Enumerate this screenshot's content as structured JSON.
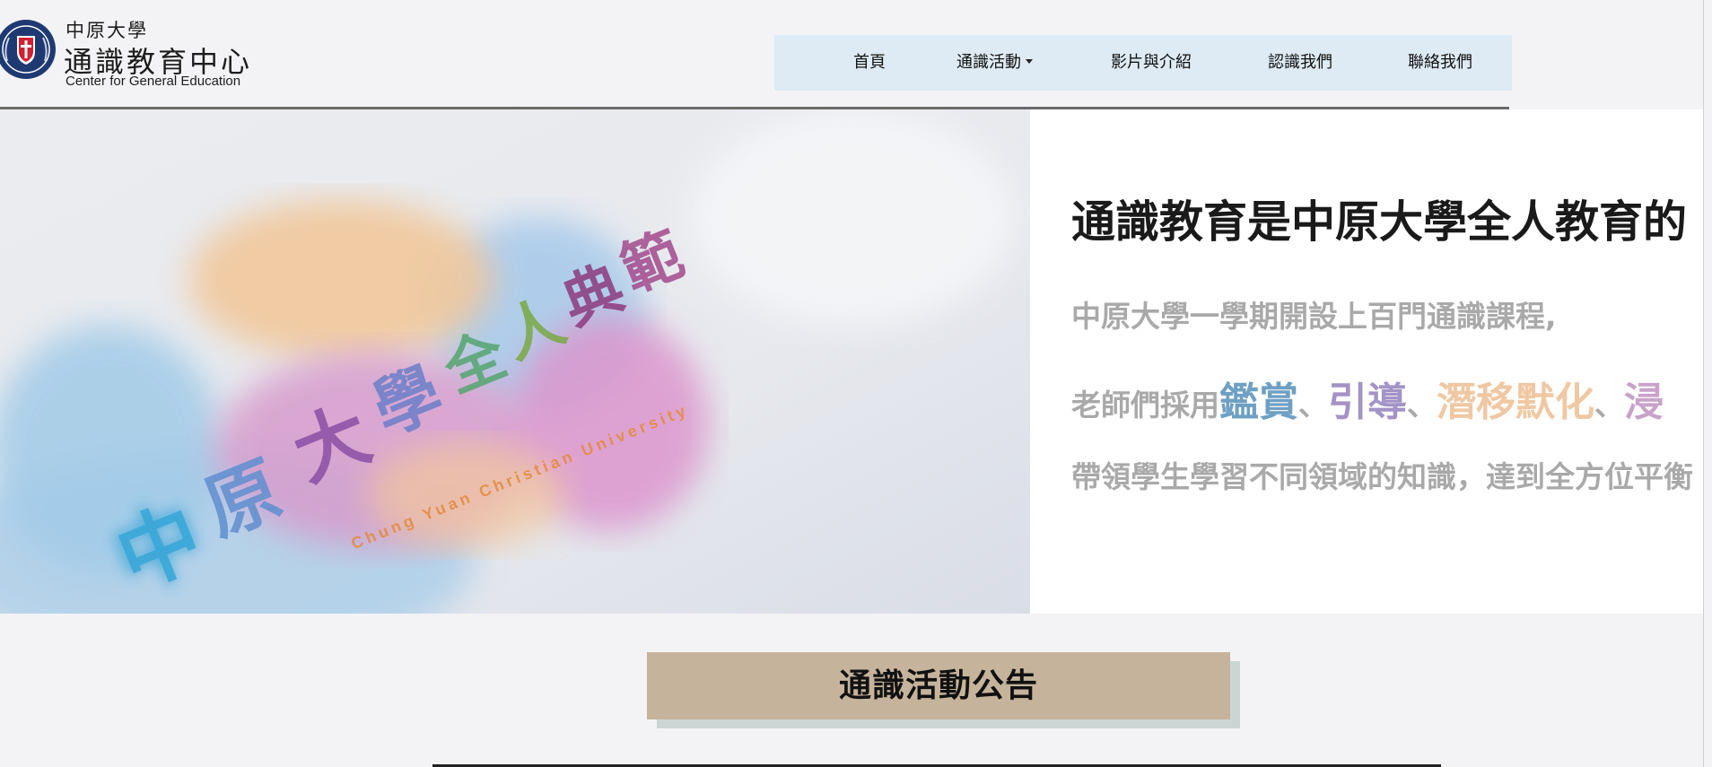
{
  "header": {
    "logo": {
      "line1": "中原大學",
      "line2": "通識教育中心",
      "line3": "Center for General Education",
      "seal_color": "#1f3a72"
    },
    "nav": [
      {
        "label": "首頁"
      },
      {
        "label": "通識活動",
        "has_dropdown": true
      },
      {
        "label": "影片與介紹"
      },
      {
        "label": "認識我們"
      },
      {
        "label": "聯絡我們"
      }
    ]
  },
  "hero": {
    "image": {
      "calligraphy": "中原大學全人典範",
      "subtitle": "Chung Yuan Christian University"
    },
    "title": "通識教育是中原大學全人教育的",
    "line1": "中原大學一學期開設上百門通識課程,",
    "line2": {
      "prefix": "老師們採用",
      "kw1": "鑑賞",
      "sep1": "、",
      "kw2": "引導",
      "sep2": "、",
      "kw3": "潛移默化",
      "sep3": "、",
      "kw4": "浸"
    },
    "line3": "帶領學生學習不同領域的知識，達到全方位平衡",
    "colors": {
      "kw1": "#6fa0c4",
      "kw2": "#a393c6",
      "kw3": "#efc8a3",
      "kw4": "#c9a2c9"
    }
  },
  "announcement": {
    "title": "通識活動公告",
    "bg_color": "#c6b39b",
    "shadow_color": "#cbd6d4"
  }
}
